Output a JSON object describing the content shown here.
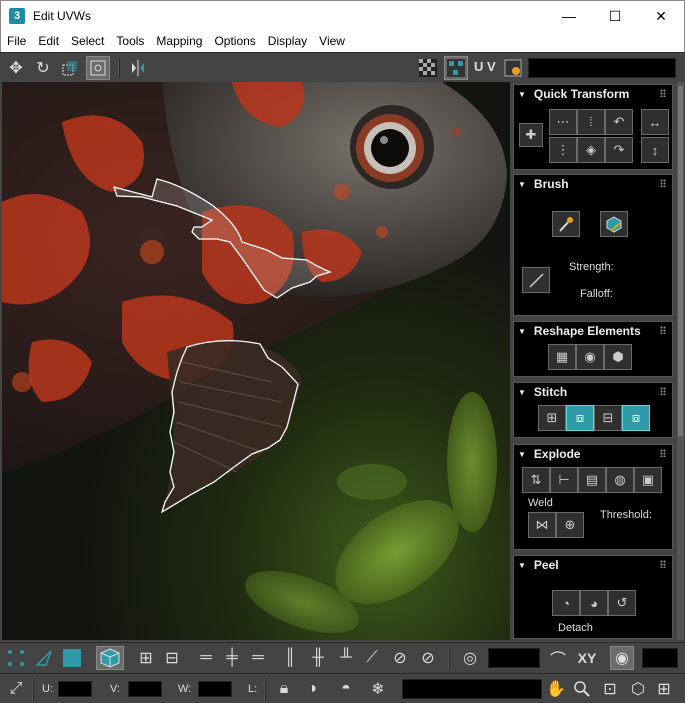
{
  "window": {
    "app_icon": "3",
    "title": "Edit UVWs",
    "minimize": "—",
    "maximize": "☐",
    "close": "✕"
  },
  "menu": [
    "File",
    "Edit",
    "Select",
    "Tools",
    "Mapping",
    "Options",
    "Display",
    "View"
  ],
  "toolbar_top": {
    "uv_label": "U V"
  },
  "panel": {
    "quick_transform": {
      "title": "Quick Transform"
    },
    "brush": {
      "title": "Brush",
      "strength_label": "Strength:",
      "falloff_label": "Falloff:"
    },
    "reshape": {
      "title": "Reshape Elements"
    },
    "stitch": {
      "title": "Stitch"
    },
    "explode": {
      "title": "Explode",
      "weld_label": "Weld",
      "threshold_label": "Threshold:"
    },
    "peel": {
      "title": "Peel",
      "detach_label": "Detach"
    }
  },
  "toolbar_bottom1": {
    "xy_label": "XY"
  },
  "toolbar_bottom2": {
    "u_label": "U:",
    "v_label": "V:",
    "w_label": "W:",
    "l_label": "L:"
  },
  "colors": {
    "accent_teal": "#2f9aa8",
    "fish_orange": "#b8361c",
    "background": "#444444"
  }
}
